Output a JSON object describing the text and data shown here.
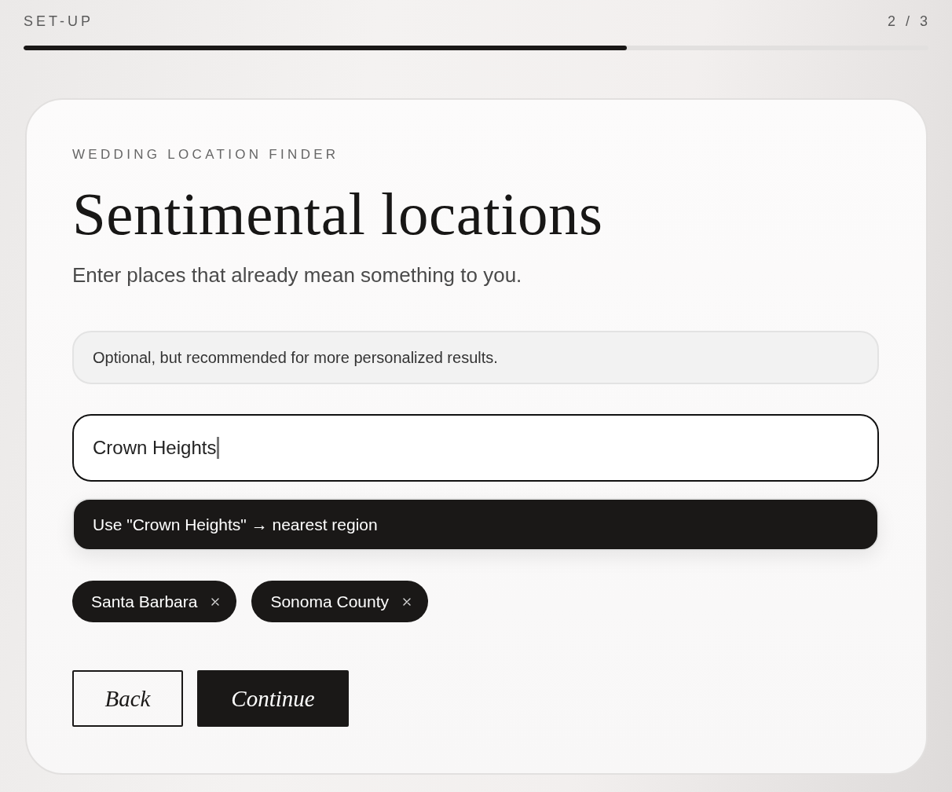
{
  "header": {
    "step_label": "SET-UP",
    "step_counter": "2 / 3",
    "progress": {
      "level": 0.667
    }
  },
  "card": {
    "eyebrow": "WEDDING LOCATION FINDER",
    "title": "Sentimental locations",
    "subtitle": "Enter places that already mean something to you.",
    "note": "Optional, but recommended for more personalized results.",
    "location_input": {
      "value": "Crown Heights",
      "focused": true
    },
    "suggestion": "Use \"Crown Heights\" → nearest region",
    "chips": [
      {
        "label": "Santa Barbara"
      },
      {
        "label": "Sonoma County"
      }
    ],
    "buttons": [
      {
        "label": "Back",
        "kind": "secondary"
      },
      {
        "label": "Continue",
        "kind": "primary"
      }
    ]
  }
}
